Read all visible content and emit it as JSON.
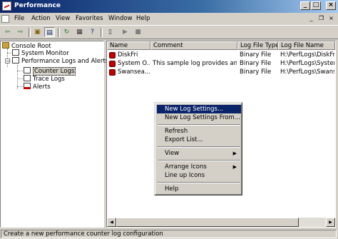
{
  "window": {
    "title": "Performance"
  },
  "menu": [
    "File",
    "Action",
    "View",
    "Favorites",
    "Window",
    "Help"
  ],
  "toolbar_icons": [
    "back-icon",
    "forward-icon",
    "up-folder-icon",
    "show-tree-icon",
    "refresh-icon",
    "properties-icon",
    "help-icon",
    "new-icon",
    "start-icon",
    "stop-icon"
  ],
  "tree": {
    "root": "Console Root",
    "system_monitor": "System Monitor",
    "perf_logs": "Performance Logs and Alerts",
    "counter_logs": "Counter Logs",
    "trace_logs": "Trace Logs",
    "alerts": "Alerts"
  },
  "list": {
    "columns": [
      "Name",
      "Comment",
      "Log File Type",
      "Log File Name"
    ],
    "rows": [
      {
        "name": "DiskFri",
        "comment": "",
        "type": "Binary File",
        "file": "H:\\PerfLogs\\DiskFri..."
      },
      {
        "name": "System O...",
        "comment": "This sample log provides an o...",
        "type": "Binary File",
        "file": "H:\\PerfLogs\\System..."
      },
      {
        "name": "Swansea...",
        "comment": "",
        "type": "Binary File",
        "file": "H:\\PerfLogs\\Swanse..."
      }
    ]
  },
  "context_menu": {
    "new_log_settings": "New Log Settings...",
    "new_log_settings_from": "New Log Settings From...",
    "refresh": "Refresh",
    "export_list": "Export List...",
    "view": "View",
    "arrange_icons": "Arrange Icons",
    "line_up_icons": "Line up Icons",
    "help": "Help"
  },
  "status": "Create a new performance counter log configuration",
  "colors": {
    "titlebar": "#0a246a",
    "highlight": "#0a246a",
    "log_icon": "#c00000"
  }
}
